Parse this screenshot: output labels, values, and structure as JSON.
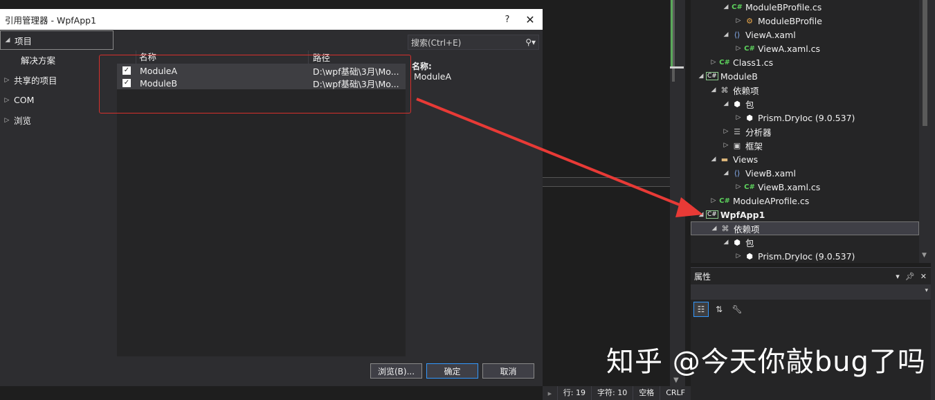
{
  "dialog": {
    "title": "引用管理器 - WpfApp1",
    "help_label": "?",
    "close_label": "✕",
    "nav": {
      "projects": "项目",
      "solution": "解决方案",
      "shared": "共享的项目",
      "com": "COM",
      "browse": "浏览"
    },
    "list": {
      "col_name": "名称",
      "col_path": "路径",
      "rows": [
        {
          "name": "ModuleA",
          "path": "D:\\wpf基础\\3月\\Mo...",
          "checked": true
        },
        {
          "name": "ModuleB",
          "path": "D:\\wpf基础\\3月\\Mo...",
          "checked": true
        }
      ]
    },
    "search_placeholder": "搜索(Ctrl+E)",
    "detail": {
      "label": "名称:",
      "value": "ModuleA"
    },
    "buttons": {
      "browse": "浏览(B)...",
      "ok": "确定",
      "cancel": "取消"
    }
  },
  "solution_tree": [
    {
      "label": "ModuleBProfile.cs",
      "icon": "csharp-file-icon",
      "indent": 3,
      "expander": "expanded"
    },
    {
      "label": "ModuleBProfile",
      "icon": "class-icon",
      "indent": 4,
      "expander": "collapsed"
    },
    {
      "label": "ViewA.xaml",
      "icon": "xaml-file-icon",
      "indent": 3,
      "expander": "expanded"
    },
    {
      "label": "ViewA.xaml.cs",
      "icon": "csharp-file-icon",
      "indent": 4,
      "expander": "collapsed"
    },
    {
      "label": "Class1.cs",
      "icon": "csharp-file-icon",
      "indent": 2,
      "expander": "collapsed"
    },
    {
      "label": "ModuleB",
      "icon": "project-icon",
      "indent": 1,
      "expander": "expanded"
    },
    {
      "label": "依赖项",
      "icon": "dependencies-icon",
      "indent": 2,
      "expander": "expanded"
    },
    {
      "label": "包",
      "icon": "package-icon",
      "indent": 3,
      "expander": "expanded"
    },
    {
      "label": "Prism.DryIoc (9.0.537)",
      "icon": "package-icon",
      "indent": 4,
      "expander": "collapsed"
    },
    {
      "label": "分析器",
      "icon": "analyzer-icon",
      "indent": 3,
      "expander": "collapsed"
    },
    {
      "label": "框架",
      "icon": "framework-icon",
      "indent": 3,
      "expander": "collapsed"
    },
    {
      "label": "Views",
      "icon": "folder-icon",
      "indent": 2,
      "expander": "expanded"
    },
    {
      "label": "ViewB.xaml",
      "icon": "xaml-file-icon",
      "indent": 3,
      "expander": "expanded"
    },
    {
      "label": "ViewB.xaml.cs",
      "icon": "csharp-file-icon",
      "indent": 4,
      "expander": "collapsed"
    },
    {
      "label": "ModuleAProfile.cs",
      "icon": "csharp-file-icon",
      "indent": 2,
      "expander": "collapsed"
    },
    {
      "label": "WpfApp1",
      "icon": "project-icon",
      "indent": 1,
      "expander": "expanded",
      "bold": true
    },
    {
      "label": "依赖项",
      "icon": "dependencies-icon",
      "indent": 2,
      "expander": "expanded",
      "selected": true
    },
    {
      "label": "包",
      "icon": "package-icon",
      "indent": 3,
      "expander": "expanded"
    },
    {
      "label": "Prism.DryIoc (9.0.537)",
      "icon": "package-icon",
      "indent": 4,
      "expander": "collapsed"
    }
  ],
  "properties": {
    "title": "属性"
  },
  "statusbar": {
    "line": "行: 19",
    "char": "字符: 10",
    "spaces": "空格",
    "eol": "CRLF"
  },
  "watermark": "知乎 @今天你敲bug了吗",
  "colors": {
    "annotation_red": "#d9302c",
    "accent_blue": "#3399ff",
    "csharp_green": "#5dd35d"
  }
}
